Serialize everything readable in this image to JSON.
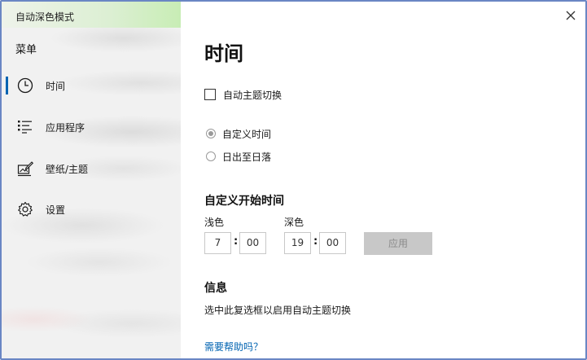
{
  "app": {
    "title": "自动深色模式"
  },
  "sidebar": {
    "heading": "菜单",
    "items": [
      {
        "label": "时间",
        "icon": "clock-icon",
        "selected": true
      },
      {
        "label": "应用程序",
        "icon": "list-icon",
        "selected": false
      },
      {
        "label": "壁纸/主题",
        "icon": "edit-picture-icon",
        "selected": false
      },
      {
        "label": "设置",
        "icon": "gear-icon",
        "selected": false
      }
    ]
  },
  "window": {
    "close_icon": "close-icon"
  },
  "main": {
    "title": "时间",
    "auto_switch": {
      "label": "自动主题切换",
      "checked": false
    },
    "mode_options": [
      {
        "label": "自定义时间",
        "selected": true
      },
      {
        "label": "日出至日落",
        "selected": false
      }
    ],
    "custom_start": {
      "heading": "自定义开始时间",
      "light": {
        "label": "浅色",
        "hour": "7",
        "minute": "00"
      },
      "dark": {
        "label": "深色",
        "hour": "19",
        "minute": "00"
      },
      "separator": ":",
      "apply_label": "应用"
    },
    "info": {
      "heading": "信息",
      "text": "选中此复选框以启用自动主题切换"
    },
    "help_link": "需要帮助吗？"
  },
  "colors": {
    "accent": "#0063b1",
    "border": "#6a86c4",
    "sidebar_bg": "#f1f1f1",
    "button_disabled": "#c8c8c8"
  }
}
